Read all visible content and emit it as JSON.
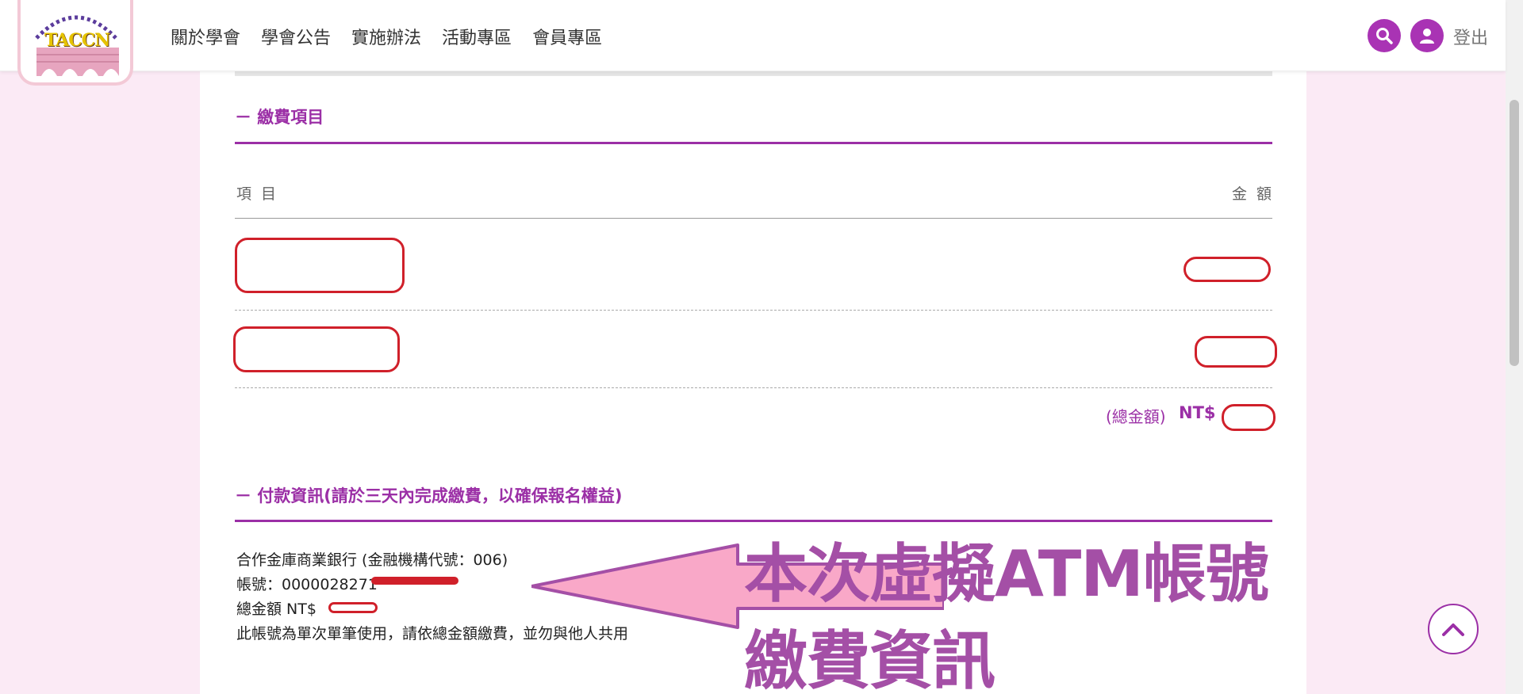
{
  "header": {
    "logo_text": "TACCN",
    "nav": [
      "關於學會",
      "學會公告",
      "實施辦法",
      "活動專區",
      "會員專區"
    ],
    "logout_label": "登出",
    "accent": "#a933b4"
  },
  "fee_section": {
    "title": "－ 繳費項目",
    "col_item": "項 目",
    "col_amount": "金 額",
    "total_label": "(總金額)",
    "total_ccy": "NT$"
  },
  "payment_section": {
    "title": "－ 付款資訊(請於三天內完成繳費，以確保報名權益)",
    "bank": "合作金庫商業銀行 (金融機構代號：006)",
    "account_prefix": "帳號：0000028271",
    "total_prefix": "總金額 NT$",
    "note": "此帳號為單次單筆使用，請依總金額繳費，並勿與他人共用"
  },
  "annotation": {
    "line1": "本次虛擬ATM帳號",
    "line2": "繳費資訊",
    "arrow_color": "#f9a8c8",
    "text_color": "#a44fa6"
  },
  "colors": {
    "redaction": "#d0202a",
    "page_bg": "#fbeaf5",
    "section_accent": "#9b2fa6"
  }
}
